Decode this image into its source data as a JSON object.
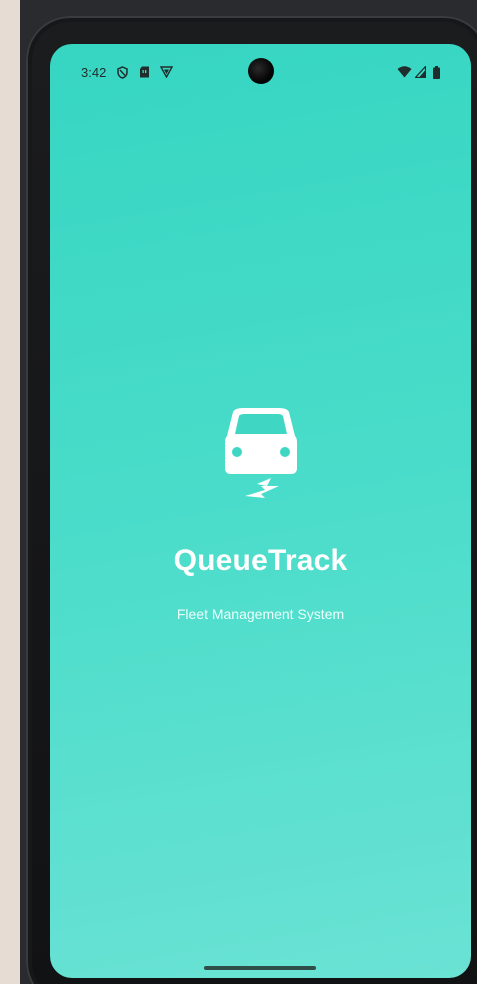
{
  "status_bar": {
    "time": "3:42",
    "left_icons": [
      "vpn-shield-icon",
      "sim-card-icon",
      "app-notification-icon"
    ],
    "right_icons": [
      "wifi-icon",
      "cellular-signal-icon",
      "battery-icon"
    ]
  },
  "splash": {
    "logo_icon": "car-charging-icon",
    "title": "QueueTrack",
    "subtitle": "Fleet Management System"
  },
  "theme": {
    "gradient_start": "#36d6c2",
    "gradient_end": "#6ae2d4",
    "text_color": "#ffffff"
  }
}
